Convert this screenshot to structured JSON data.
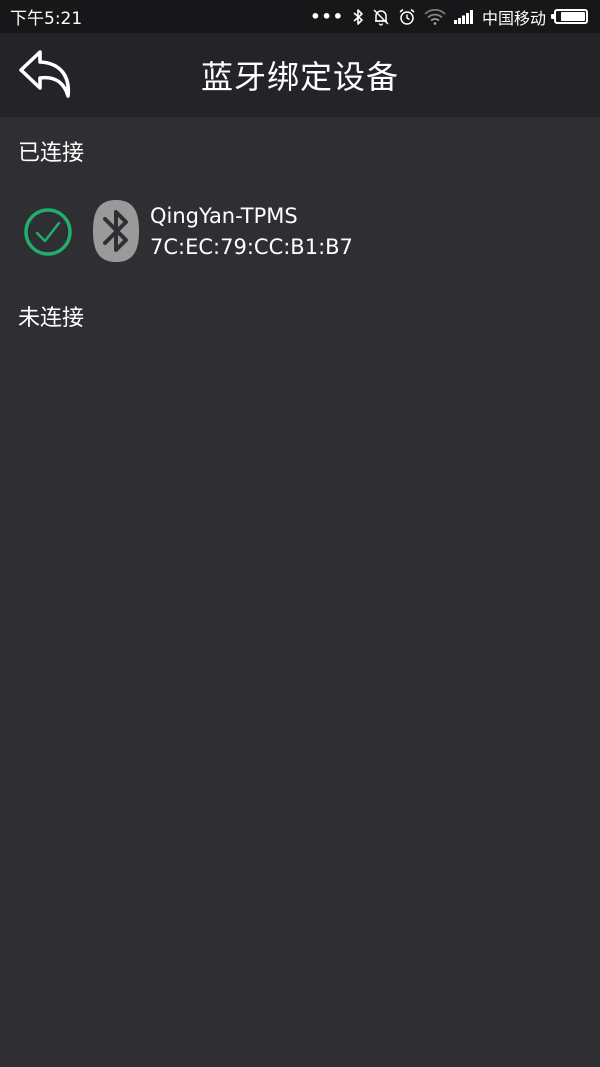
{
  "status_bar": {
    "time": "下午5:21",
    "dots": "•••",
    "carrier": "中国移动",
    "battery_level": 0.85,
    "icons": [
      "bluetooth-icon",
      "mute-bell-icon",
      "alarm-icon",
      "wifi-icon",
      "signal-icon",
      "battery-icon"
    ]
  },
  "header": {
    "title": "蓝牙绑定设备",
    "back_icon": "back-arrow-icon"
  },
  "connected_section": {
    "label": "已连接",
    "devices": [
      {
        "name": "QingYan-TPMS",
        "mac": "7C:EC:79:CC:B1:B7",
        "status_icon": "check-circle-icon",
        "type_icon": "bluetooth-icon"
      }
    ]
  },
  "disconnected_section": {
    "label": "未连接"
  },
  "colors": {
    "background": "#2f2f33",
    "header": "#242428",
    "status_bar": "#17171a",
    "check_green": "#1fae6e",
    "bt_badge": "#9a9a9a",
    "text": "#ffffff"
  }
}
